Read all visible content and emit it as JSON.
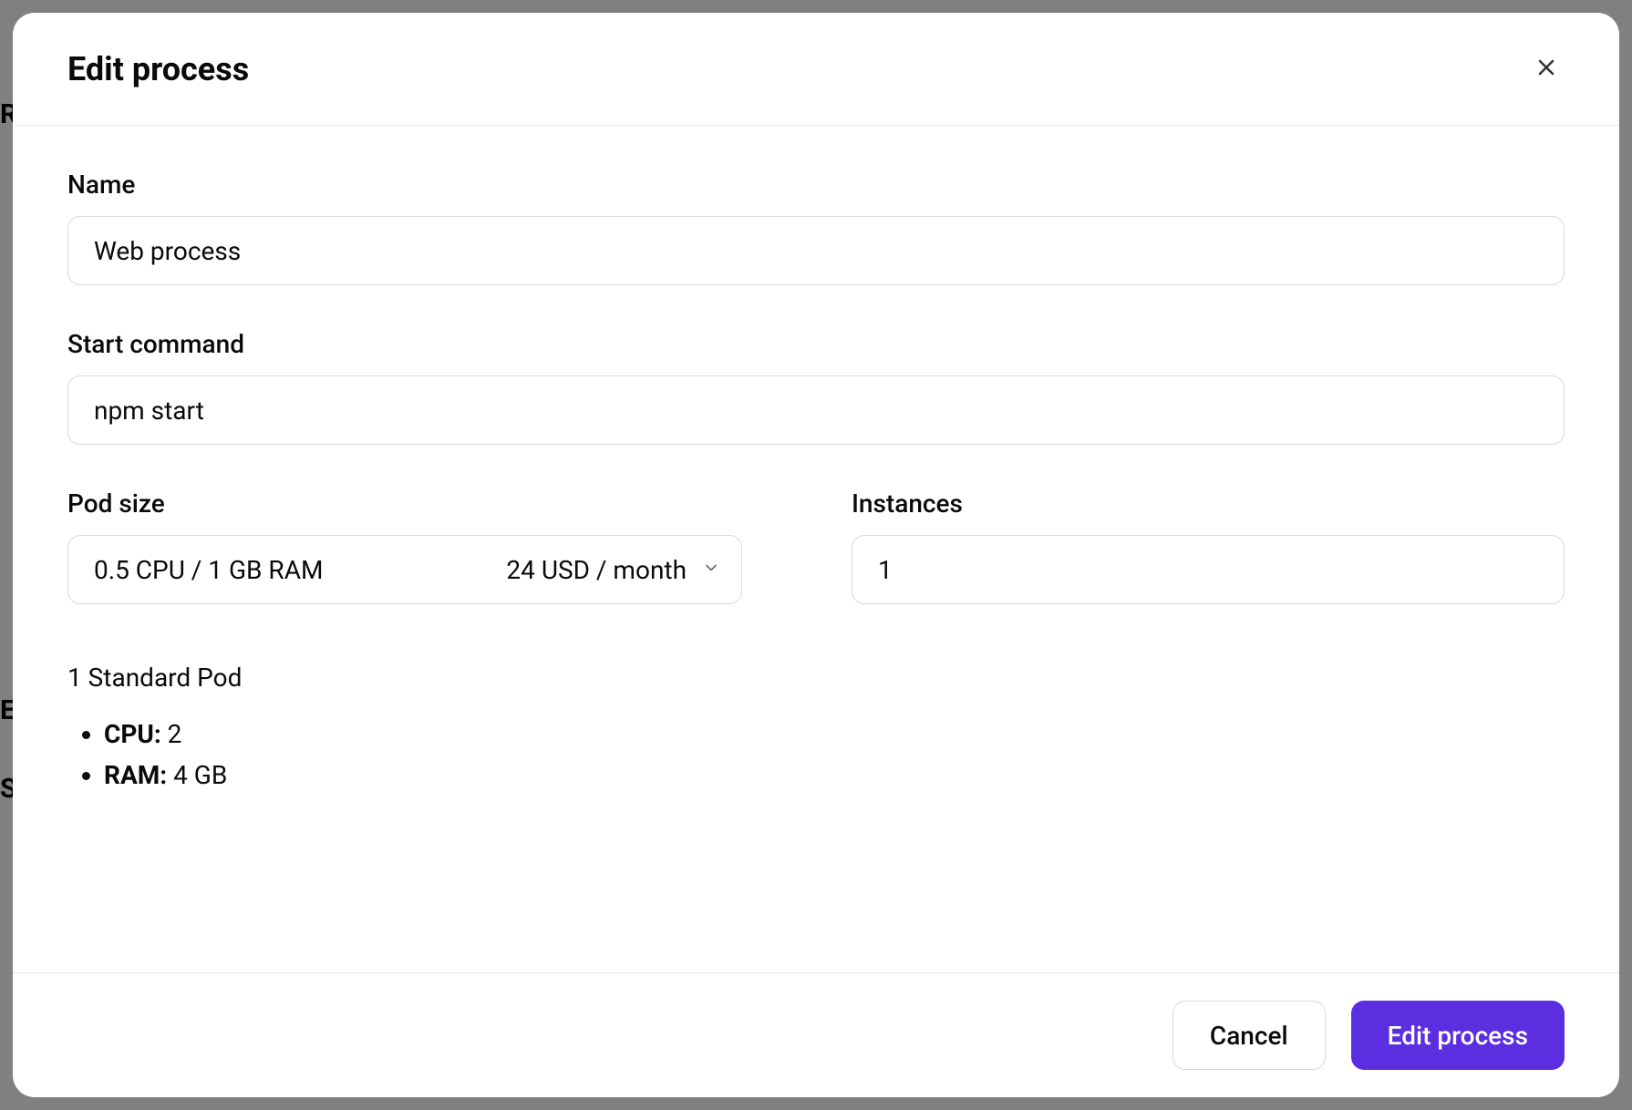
{
  "modal": {
    "title": "Edit process",
    "fields": {
      "name": {
        "label": "Name",
        "value": "Web process"
      },
      "start_command": {
        "label": "Start command",
        "value": "npm start"
      },
      "pod_size": {
        "label": "Pod size",
        "spec": "0.5 CPU / 1 GB RAM",
        "price": "24 USD / month"
      },
      "instances": {
        "label": "Instances",
        "value": "1"
      }
    },
    "summary": {
      "title": "1 Standard Pod",
      "cpu_label": "CPU:",
      "cpu_value": " 2",
      "ram_label": "RAM:",
      "ram_value": " 4 GB"
    },
    "actions": {
      "cancel": "Cancel",
      "submit": "Edit process"
    }
  },
  "background": {
    "r": "R",
    "e": "E",
    "s": "S"
  }
}
